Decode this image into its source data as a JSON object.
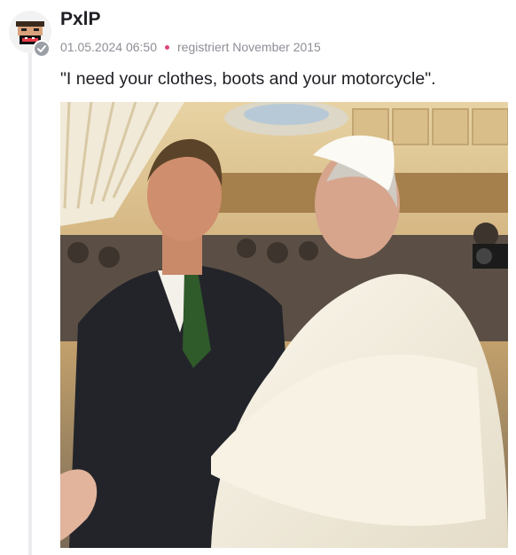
{
  "post": {
    "username": "PxlP",
    "timestamp": "01.05.2024 06:50",
    "registered": "registriert November 2015",
    "text": "\"I need your clothes, boots and your motorcycle\".",
    "accent_dot_color": "#e0457b"
  },
  "icons": {
    "avatar": "avatar-face-icon",
    "badge": "check-badge-icon"
  }
}
